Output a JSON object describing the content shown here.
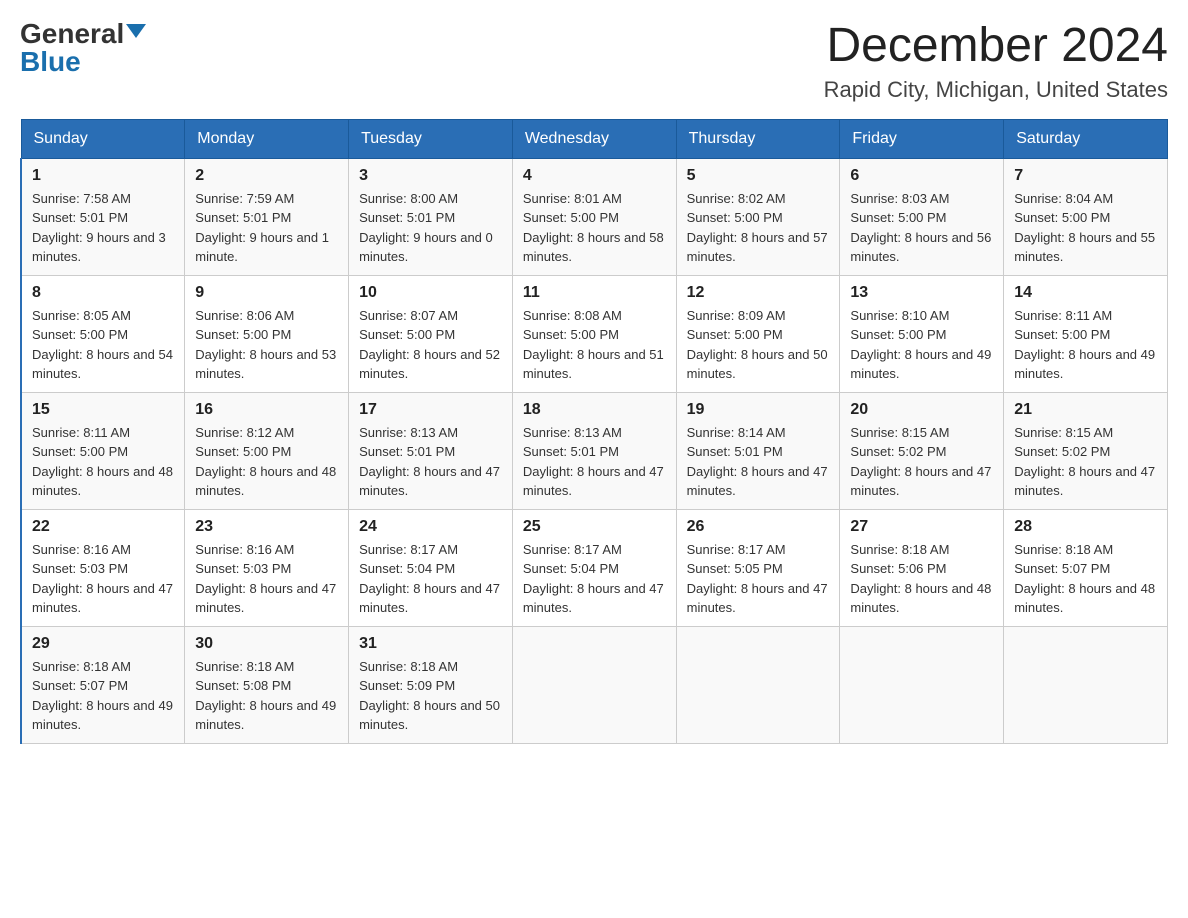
{
  "logo": {
    "general": "General",
    "blue": "Blue"
  },
  "title": {
    "month_year": "December 2024",
    "location": "Rapid City, Michigan, United States"
  },
  "days_of_week": [
    "Sunday",
    "Monday",
    "Tuesday",
    "Wednesday",
    "Thursday",
    "Friday",
    "Saturday"
  ],
  "weeks": [
    [
      {
        "day": "1",
        "sunrise": "7:58 AM",
        "sunset": "5:01 PM",
        "daylight": "9 hours and 3 minutes."
      },
      {
        "day": "2",
        "sunrise": "7:59 AM",
        "sunset": "5:01 PM",
        "daylight": "9 hours and 1 minute."
      },
      {
        "day": "3",
        "sunrise": "8:00 AM",
        "sunset": "5:01 PM",
        "daylight": "9 hours and 0 minutes."
      },
      {
        "day": "4",
        "sunrise": "8:01 AM",
        "sunset": "5:00 PM",
        "daylight": "8 hours and 58 minutes."
      },
      {
        "day": "5",
        "sunrise": "8:02 AM",
        "sunset": "5:00 PM",
        "daylight": "8 hours and 57 minutes."
      },
      {
        "day": "6",
        "sunrise": "8:03 AM",
        "sunset": "5:00 PM",
        "daylight": "8 hours and 56 minutes."
      },
      {
        "day": "7",
        "sunrise": "8:04 AM",
        "sunset": "5:00 PM",
        "daylight": "8 hours and 55 minutes."
      }
    ],
    [
      {
        "day": "8",
        "sunrise": "8:05 AM",
        "sunset": "5:00 PM",
        "daylight": "8 hours and 54 minutes."
      },
      {
        "day": "9",
        "sunrise": "8:06 AM",
        "sunset": "5:00 PM",
        "daylight": "8 hours and 53 minutes."
      },
      {
        "day": "10",
        "sunrise": "8:07 AM",
        "sunset": "5:00 PM",
        "daylight": "8 hours and 52 minutes."
      },
      {
        "day": "11",
        "sunrise": "8:08 AM",
        "sunset": "5:00 PM",
        "daylight": "8 hours and 51 minutes."
      },
      {
        "day": "12",
        "sunrise": "8:09 AM",
        "sunset": "5:00 PM",
        "daylight": "8 hours and 50 minutes."
      },
      {
        "day": "13",
        "sunrise": "8:10 AM",
        "sunset": "5:00 PM",
        "daylight": "8 hours and 49 minutes."
      },
      {
        "day": "14",
        "sunrise": "8:11 AM",
        "sunset": "5:00 PM",
        "daylight": "8 hours and 49 minutes."
      }
    ],
    [
      {
        "day": "15",
        "sunrise": "8:11 AM",
        "sunset": "5:00 PM",
        "daylight": "8 hours and 48 minutes."
      },
      {
        "day": "16",
        "sunrise": "8:12 AM",
        "sunset": "5:00 PM",
        "daylight": "8 hours and 48 minutes."
      },
      {
        "day": "17",
        "sunrise": "8:13 AM",
        "sunset": "5:01 PM",
        "daylight": "8 hours and 47 minutes."
      },
      {
        "day": "18",
        "sunrise": "8:13 AM",
        "sunset": "5:01 PM",
        "daylight": "8 hours and 47 minutes."
      },
      {
        "day": "19",
        "sunrise": "8:14 AM",
        "sunset": "5:01 PM",
        "daylight": "8 hours and 47 minutes."
      },
      {
        "day": "20",
        "sunrise": "8:15 AM",
        "sunset": "5:02 PM",
        "daylight": "8 hours and 47 minutes."
      },
      {
        "day": "21",
        "sunrise": "8:15 AM",
        "sunset": "5:02 PM",
        "daylight": "8 hours and 47 minutes."
      }
    ],
    [
      {
        "day": "22",
        "sunrise": "8:16 AM",
        "sunset": "5:03 PM",
        "daylight": "8 hours and 47 minutes."
      },
      {
        "day": "23",
        "sunrise": "8:16 AM",
        "sunset": "5:03 PM",
        "daylight": "8 hours and 47 minutes."
      },
      {
        "day": "24",
        "sunrise": "8:17 AM",
        "sunset": "5:04 PM",
        "daylight": "8 hours and 47 minutes."
      },
      {
        "day": "25",
        "sunrise": "8:17 AM",
        "sunset": "5:04 PM",
        "daylight": "8 hours and 47 minutes."
      },
      {
        "day": "26",
        "sunrise": "8:17 AM",
        "sunset": "5:05 PM",
        "daylight": "8 hours and 47 minutes."
      },
      {
        "day": "27",
        "sunrise": "8:18 AM",
        "sunset": "5:06 PM",
        "daylight": "8 hours and 48 minutes."
      },
      {
        "day": "28",
        "sunrise": "8:18 AM",
        "sunset": "5:07 PM",
        "daylight": "8 hours and 48 minutes."
      }
    ],
    [
      {
        "day": "29",
        "sunrise": "8:18 AM",
        "sunset": "5:07 PM",
        "daylight": "8 hours and 49 minutes."
      },
      {
        "day": "30",
        "sunrise": "8:18 AM",
        "sunset": "5:08 PM",
        "daylight": "8 hours and 49 minutes."
      },
      {
        "day": "31",
        "sunrise": "8:18 AM",
        "sunset": "5:09 PM",
        "daylight": "8 hours and 50 minutes."
      },
      null,
      null,
      null,
      null
    ]
  ],
  "labels": {
    "sunrise": "Sunrise:",
    "sunset": "Sunset:",
    "daylight": "Daylight:"
  }
}
